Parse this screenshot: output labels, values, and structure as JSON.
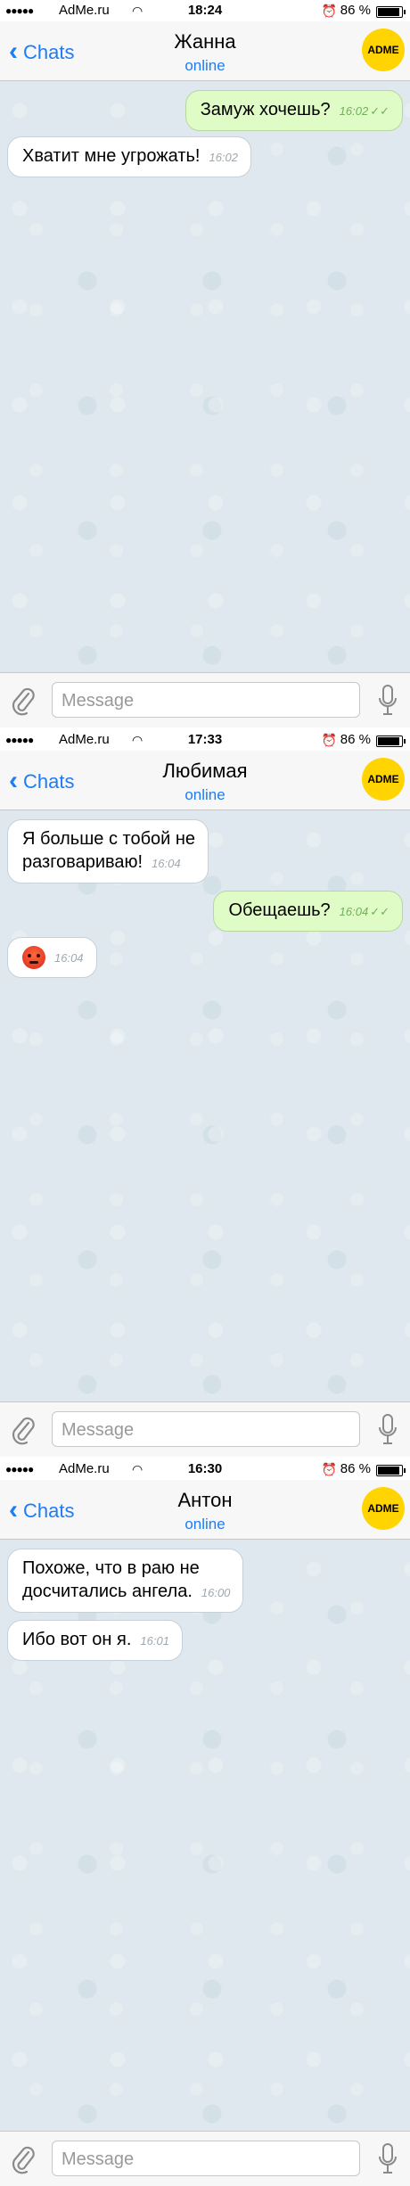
{
  "screens": [
    {
      "statusbar": {
        "signal": "●●●●●",
        "carrier": "AdMe.ru",
        "time": "18:24",
        "battery": "86 %"
      },
      "header": {
        "back_label": "Chats",
        "contact_name": "Жанна",
        "contact_status": "online",
        "avatar_text": "ADME"
      },
      "messages": [
        {
          "direction": "out",
          "text": "Замуж хочешь?",
          "time": "16:02"
        },
        {
          "direction": "in",
          "text": "Хватит мне угрожать!",
          "time": "16:02"
        }
      ],
      "input": {
        "placeholder": "Message"
      }
    },
    {
      "statusbar": {
        "signal": "●●●●●",
        "carrier": "AdMe.ru",
        "time": "17:33",
        "battery": "86 %"
      },
      "header": {
        "back_label": "Chats",
        "contact_name": "Любимая",
        "contact_status": "online",
        "avatar_text": "ADME"
      },
      "messages": [
        {
          "direction": "in",
          "text_line1": "Я больше с тобой не",
          "text_line2": "разговариваю!",
          "time": "16:04"
        },
        {
          "direction": "out",
          "text": "Обещаешь?",
          "time": "16:04"
        },
        {
          "direction": "in",
          "emoji": "angry-face-emoji",
          "time": "16:04"
        }
      ],
      "input": {
        "placeholder": "Message"
      }
    },
    {
      "statusbar": {
        "signal": "●●●●●",
        "carrier": "AdMe.ru",
        "time": "16:30",
        "battery": "86 %"
      },
      "header": {
        "back_label": "Chats",
        "contact_name": "Антон",
        "contact_status": "online",
        "avatar_text": "ADME"
      },
      "messages": [
        {
          "direction": "in",
          "text_line1": "Похоже, что в раю не",
          "text_line2": "досчитались ангела.",
          "time": "16:00"
        },
        {
          "direction": "in",
          "text": "Ибо вот он я.",
          "time": "16:01"
        }
      ],
      "input": {
        "placeholder": "Message"
      }
    }
  ],
  "icons": {
    "wifi": "wifi-icon",
    "alarm": "alarm-icon",
    "battery": "battery-icon",
    "back": "chevron-left-icon",
    "attach": "paperclip-icon",
    "mic": "microphone-icon",
    "read": "double-check-icon"
  },
  "colors": {
    "accent": "#1e7cf5",
    "outgoing_bubble": "#e0fcc6",
    "incoming_bubble": "#ffffff",
    "chat_background": "#dfe8ee",
    "avatar": "#ffd400"
  }
}
